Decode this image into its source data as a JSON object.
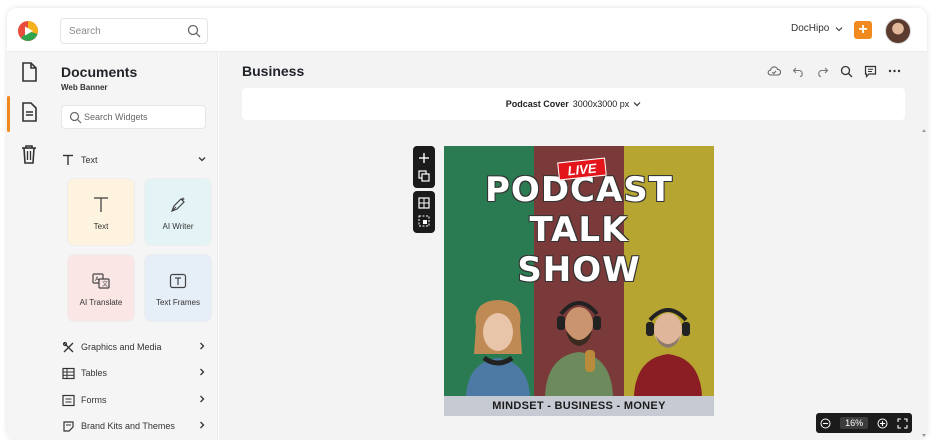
{
  "header": {
    "search_placeholder": "Search",
    "account_name": "DocHipo",
    "plus_label": "+"
  },
  "rail": {
    "items": [
      {
        "icon": "document-icon"
      },
      {
        "icon": "page-icon"
      },
      {
        "icon": "trash-icon"
      }
    ]
  },
  "panel": {
    "title": "Documents",
    "subtitle": "Web Banner",
    "search_placeholder": "Search Widgets",
    "text_section": "Text",
    "tiles": [
      {
        "label": "Text",
        "bg": "#fdf3df"
      },
      {
        "label": "AI Writer",
        "bg": "#e4f4f6"
      },
      {
        "label": "AI Translate",
        "bg": "#fbe6e6"
      },
      {
        "label": "Text Frames",
        "bg": "#e6eef8"
      }
    ],
    "sections": [
      {
        "label": "Graphics and Media"
      },
      {
        "label": "Tables"
      },
      {
        "label": "Forms"
      },
      {
        "label": "Brand Kits and Themes"
      }
    ]
  },
  "main": {
    "doc_title": "Business",
    "format_name": "Podcast Cover",
    "format_size": "3000x3000 px",
    "zoom": "16%"
  },
  "design": {
    "live_badge": "LIVE",
    "line1": "PODCAST",
    "line2": "TALK",
    "line3": "SHOW",
    "footer": "MINDSET - BUSINESS - MONEY",
    "colors": {
      "green": "#2a7b52",
      "maroon": "#7b3a3a",
      "olive": "#b7a531",
      "accent": "#f08a1f"
    }
  }
}
